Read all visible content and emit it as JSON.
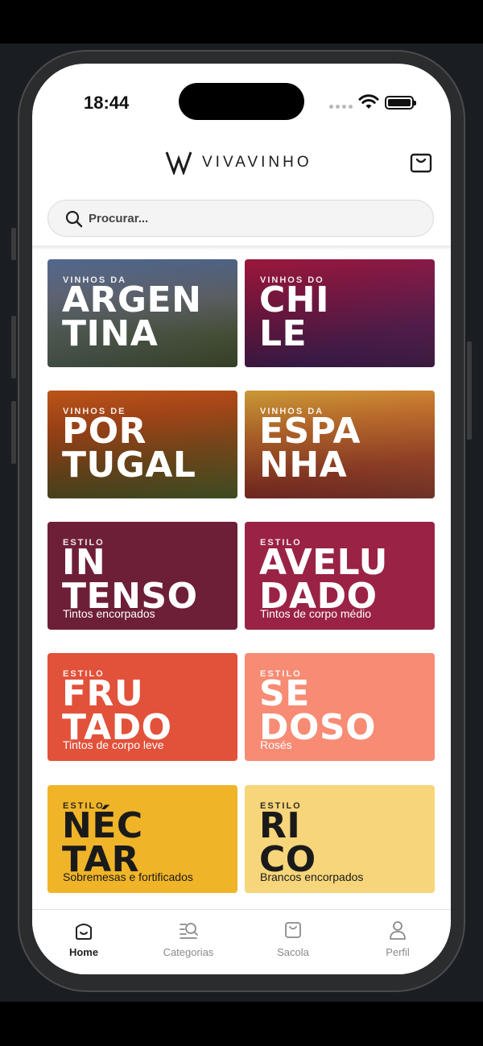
{
  "status_bar": {
    "time": "18:44"
  },
  "header": {
    "brand_name": "VIVAVINHO"
  },
  "search": {
    "placeholder": "Procurar..."
  },
  "categories": [
    {
      "kicker": "VINHOS DA",
      "line1": "ARGEN",
      "line2": "TINA",
      "subtitle": ""
    },
    {
      "kicker": "VINHOS DO",
      "line1": "CHI",
      "line2": "LE",
      "subtitle": ""
    },
    {
      "kicker": "VINHOS DE",
      "line1": "POR",
      "line2": "TUGAL",
      "subtitle": ""
    },
    {
      "kicker": "VINHOS DA",
      "line1": "ESPA",
      "line2": "NHA",
      "subtitle": ""
    },
    {
      "kicker": "ESTILO",
      "line1": "IN",
      "line2": "TENSO",
      "subtitle": "Tintos encorpados"
    },
    {
      "kicker": "ESTILO",
      "line1": "AVELU",
      "line2": "DADO",
      "subtitle": "Tintos de corpo médio"
    },
    {
      "kicker": "ESTILO",
      "line1": "FRU",
      "line2": "TADO",
      "subtitle": "Tintos de corpo leve"
    },
    {
      "kicker": "ESTILO",
      "line1": "SE",
      "line2": "DOSO",
      "subtitle": "Rosés"
    },
    {
      "kicker": "ESTILO",
      "line1": "NÉC",
      "line2": "TAR",
      "subtitle": "Sobremesas e fortificados"
    },
    {
      "kicker": "ESTILO",
      "line1": "RI",
      "line2": "CO",
      "subtitle": "Brancos encorpados"
    }
  ],
  "tabbar": {
    "items": [
      {
        "label": "Home",
        "icon": "home-icon",
        "active": true
      },
      {
        "label": "Categorias",
        "icon": "categories-search-icon",
        "active": false
      },
      {
        "label": "Sacola",
        "icon": "bag-icon",
        "active": false
      },
      {
        "label": "Perfil",
        "icon": "person-icon",
        "active": false
      }
    ]
  },
  "colors": {
    "intenso": "#6e1f38",
    "aveludado": "#9a2245",
    "frutado": "#e2513a",
    "sedoso": "#f78b74",
    "nectar": "#f0b429",
    "rico": "#f7d57a"
  }
}
